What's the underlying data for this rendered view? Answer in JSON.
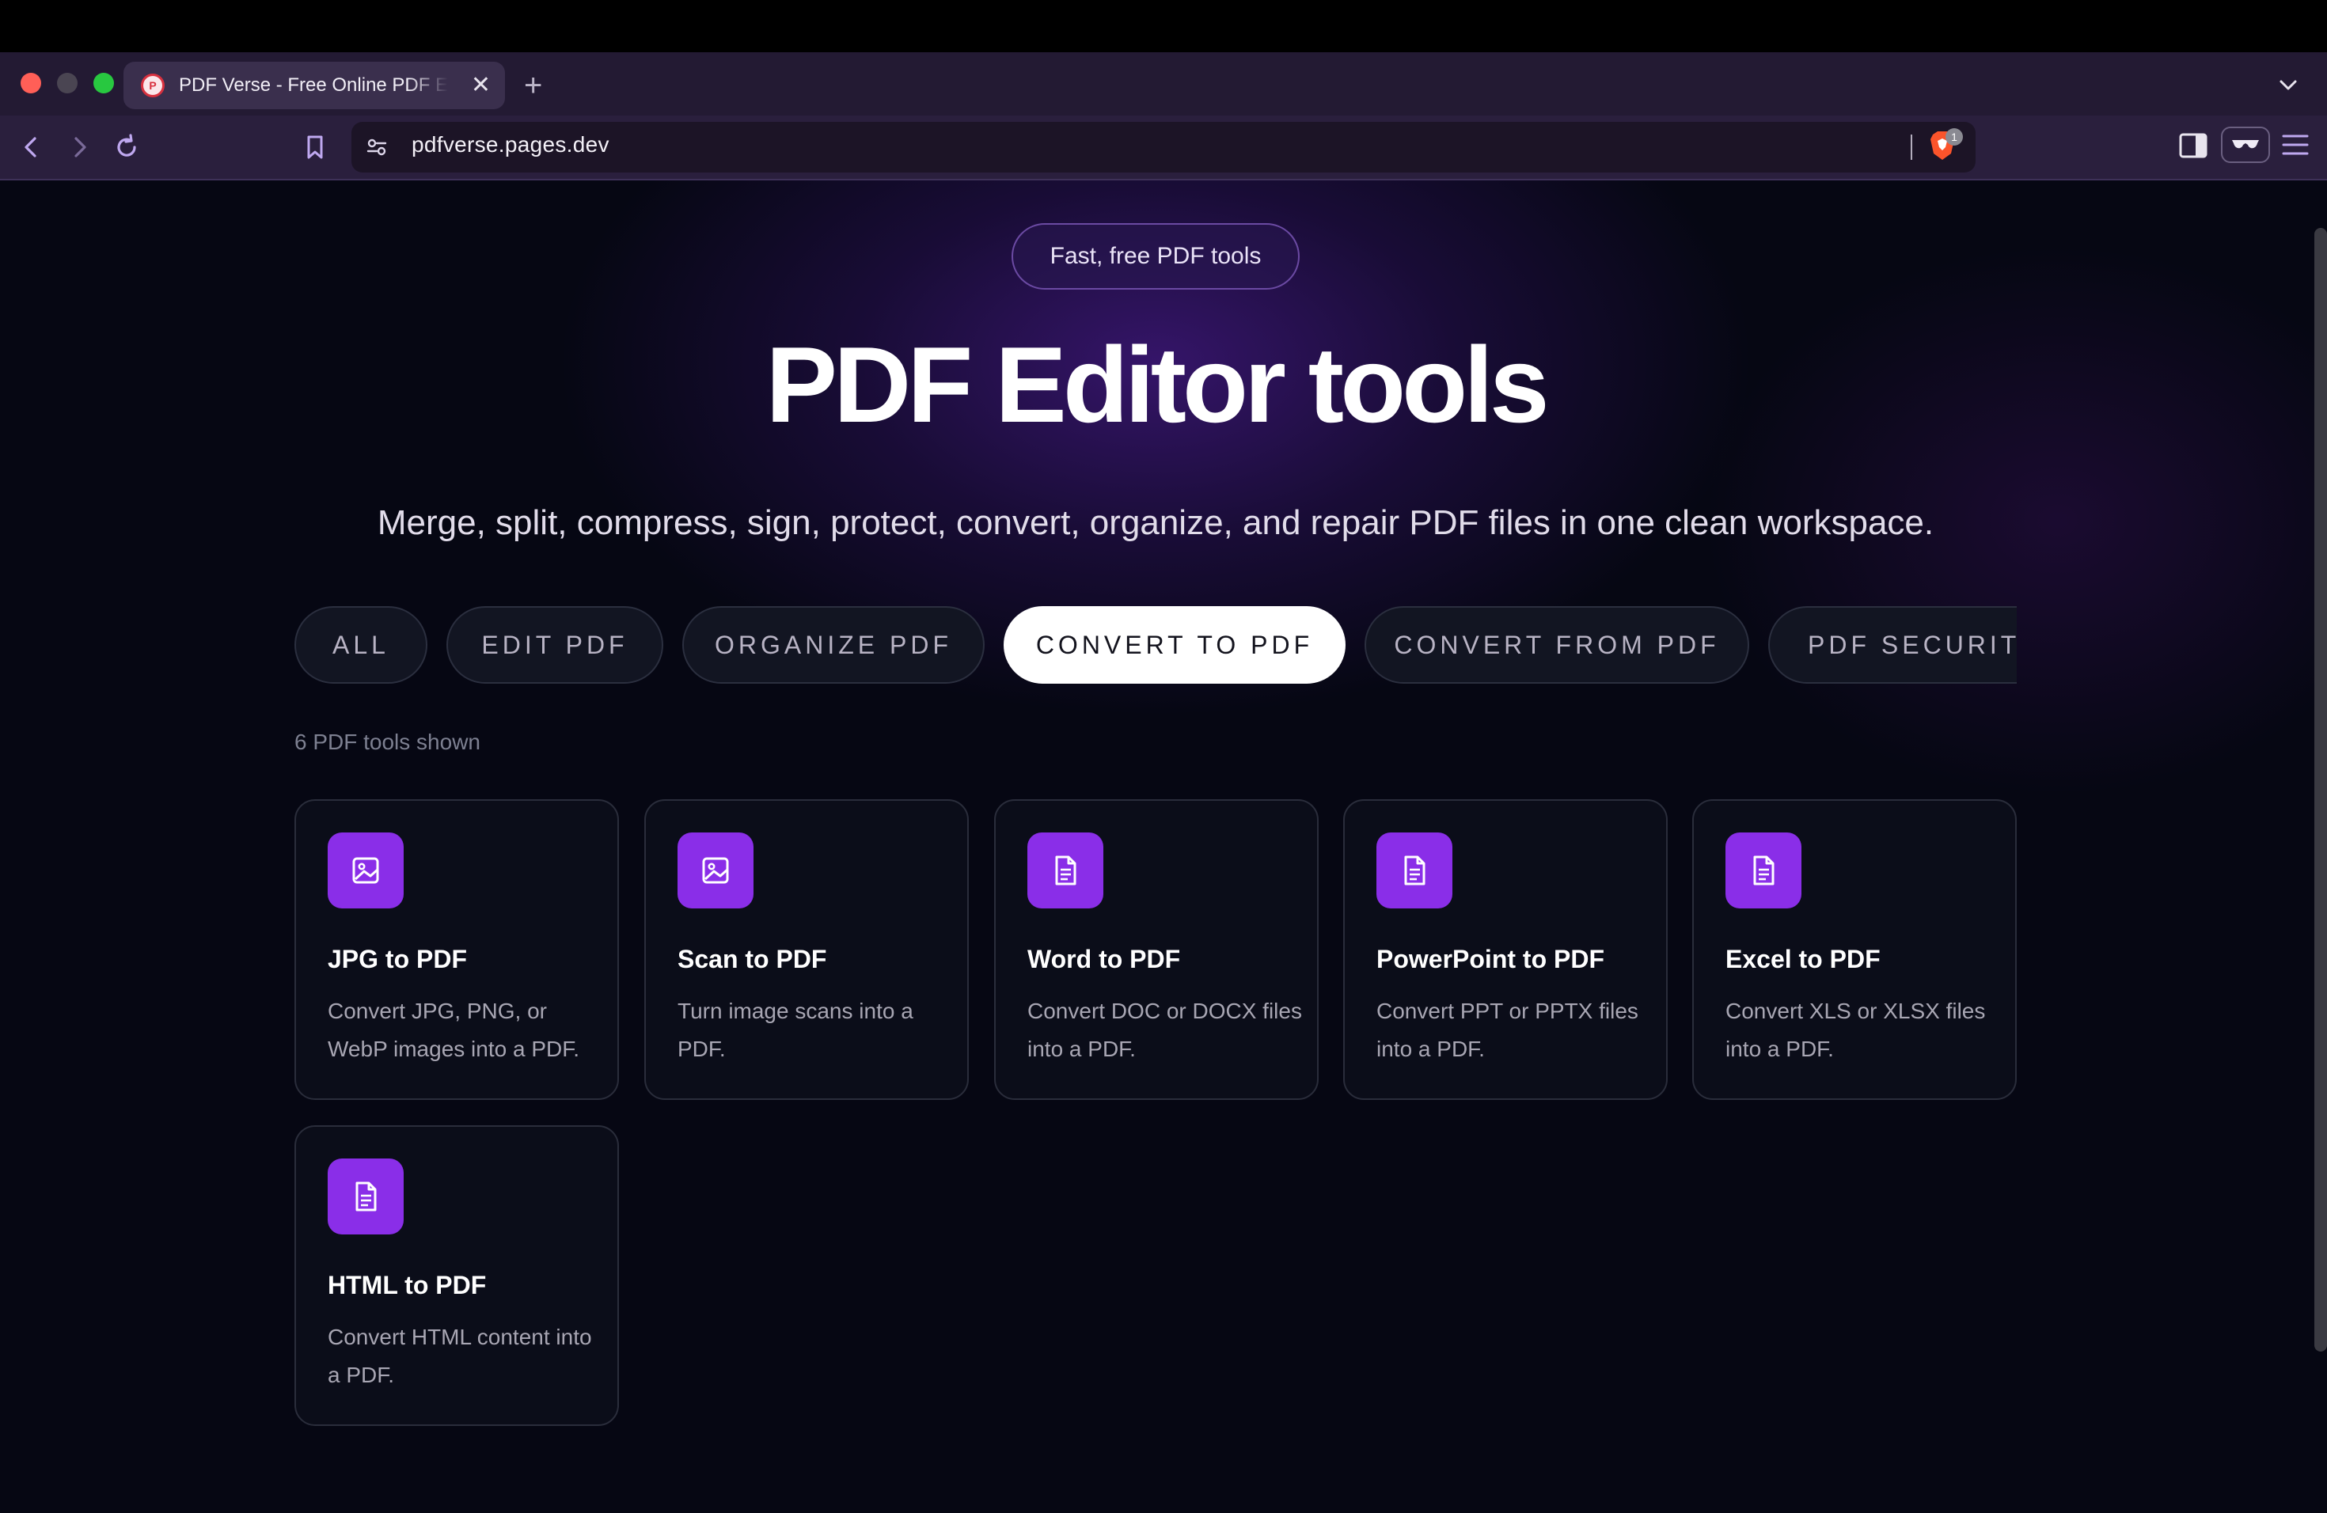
{
  "browser": {
    "tab_title": "PDF Verse - Free Online PDF Editor",
    "tab_close": "✕",
    "new_tab": "+",
    "favicon_letter": "P",
    "url": "pdfverse.pages.dev",
    "shield_count": "1"
  },
  "hero": {
    "pill": "Fast, free PDF tools",
    "title": "PDF Editor tools",
    "subtitle": "Merge, split, compress, sign, protect, convert, organize, and repair PDF files in one clean workspace."
  },
  "filters": [
    {
      "label": "ALL",
      "active": false
    },
    {
      "label": "EDIT PDF",
      "active": false
    },
    {
      "label": "ORGANIZE PDF",
      "active": false
    },
    {
      "label": "CONVERT TO PDF",
      "active": true
    },
    {
      "label": "CONVERT FROM PDF",
      "active": false
    },
    {
      "label": "PDF SECURITY",
      "active": false
    }
  ],
  "count_text": "6 PDF tools shown",
  "tools": [
    {
      "icon": "image-icon",
      "title": "JPG to PDF",
      "desc": "Convert JPG, PNG, or WebP images into a PDF."
    },
    {
      "icon": "image-icon",
      "title": "Scan to PDF",
      "desc": "Turn image scans into a PDF."
    },
    {
      "icon": "document-icon",
      "title": "Word to PDF",
      "desc": "Convert DOC or DOCX files into a PDF."
    },
    {
      "icon": "document-icon",
      "title": "PowerPoint to PDF",
      "desc": "Convert PPT or PPTX files into a PDF."
    },
    {
      "icon": "document-icon",
      "title": "Excel to PDF",
      "desc": "Convert XLS or XLSX files into a PDF."
    },
    {
      "icon": "document-icon",
      "title": "HTML to PDF",
      "desc": "Convert HTML content into a PDF."
    }
  ],
  "colors": {
    "accent": "#8a2ee8",
    "page_bg": "#060713",
    "chrome_bg": "#2a1f3d"
  }
}
